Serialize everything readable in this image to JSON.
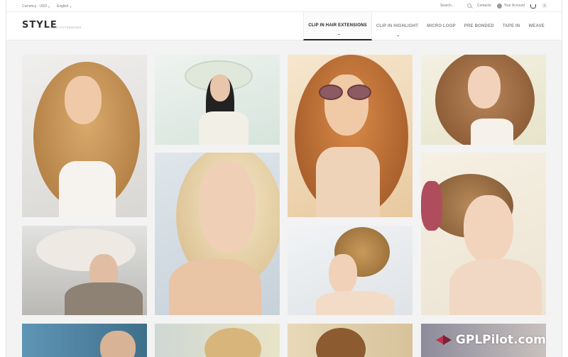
{
  "topbar": {
    "currency_label": "Currency : USD",
    "language_label": "English",
    "search_label": "Search...",
    "contacts_label": "Contacts",
    "account_label": "Your Account",
    "cart_count": "0"
  },
  "header": {
    "logo": "STYLE",
    "logo_sub": "HAIR EXTENSIONS"
  },
  "nav": {
    "items": [
      {
        "label": "CLIP IN HAIR EXTENSIONS"
      },
      {
        "label": "CLIP IN HIGHLIGHT"
      },
      {
        "label": "MICRO LOOP"
      },
      {
        "label": "PRE BONDED"
      },
      {
        "label": "TAPE IN"
      },
      {
        "label": "WEAVE"
      }
    ]
  },
  "watermark": {
    "text": "GPLPilot.com"
  },
  "colors": {
    "accent": "#222222",
    "watermark_red": "#c0304a"
  }
}
